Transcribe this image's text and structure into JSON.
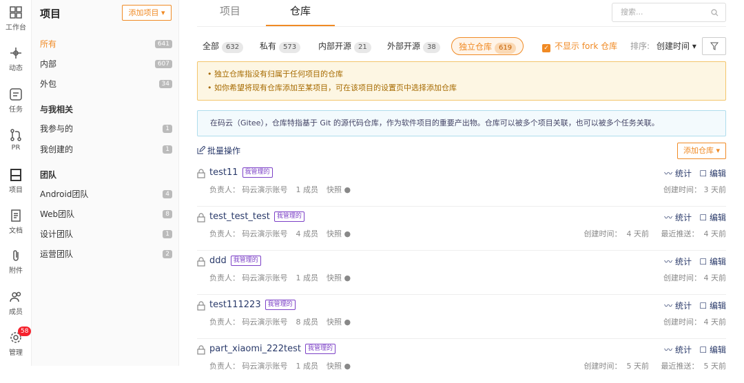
{
  "rail": [
    {
      "label": "工作台",
      "icon": "dashboard-icon"
    },
    {
      "label": "动态",
      "icon": "activity-icon"
    },
    {
      "label": "任务",
      "icon": "task-icon"
    },
    {
      "label": "PR",
      "icon": "pull-request-icon"
    },
    {
      "label": "项目",
      "icon": "project-icon"
    },
    {
      "label": "文档",
      "icon": "document-icon"
    },
    {
      "label": "附件",
      "icon": "attachment-icon"
    },
    {
      "label": "成员",
      "icon": "members-icon"
    },
    {
      "label": "管理",
      "icon": "settings-icon",
      "badge": "58"
    }
  ],
  "sidebar": {
    "title": "项目",
    "add_label": "添加项目 ▾",
    "items": [
      {
        "label": "所有",
        "count": "641"
      },
      {
        "label": "内部",
        "count": "607"
      },
      {
        "label": "外包",
        "count": "34"
      }
    ],
    "related_head": "与我相关",
    "related": [
      {
        "label": "我参与的",
        "count": "1"
      },
      {
        "label": "我创建的",
        "count": "1"
      }
    ],
    "team_head": "团队",
    "teams": [
      {
        "label": "Android团队",
        "count": "4"
      },
      {
        "label": "Web团队",
        "count": "8"
      },
      {
        "label": "设计团队",
        "count": "1"
      },
      {
        "label": "运营团队",
        "count": "2"
      }
    ]
  },
  "tabs": {
    "projects": "项目",
    "repos": "仓库"
  },
  "search": {
    "placeholder": "搜索..."
  },
  "filters": [
    {
      "label": "全部",
      "count": "632"
    },
    {
      "label": "私有",
      "count": "573"
    },
    {
      "label": "内部开源",
      "count": "21"
    },
    {
      "label": "外部开源",
      "count": "38"
    },
    {
      "label": "独立仓库",
      "count": "619"
    }
  ],
  "hide_fork": "不显示 fork 仓库",
  "sort": {
    "label": "排序:",
    "value": "创建时间 ▾"
  },
  "warn": {
    "line1": "独立仓库指没有归属于任何项目的仓库",
    "line2": "如你希望将现有仓库添加至某项目，可在该项目的设置页中选择添加仓库"
  },
  "info": "在码云（Gitee），仓库特指基于 Git 的源代码仓库，作为软件项目的重要产出物。仓库可以被多个项目关联，也可以被多个任务关联。",
  "batch": "批量操作",
  "add_repo": "添加仓库 ▾",
  "actions": {
    "stats": "统计",
    "edit": "编辑"
  },
  "repos": [
    {
      "name": "test11",
      "tag": "我管理的",
      "owner": "负责人：  码云演示账号",
      "members": "1 成员",
      "snapshot": "快照 ●",
      "right": "创建时间：  3 天前"
    },
    {
      "name": "test_test_test",
      "tag": "我管理的",
      "owner": "负责人：  码云演示账号",
      "members": "4 成员",
      "snapshot": "快照 ●",
      "right": "创建时间：  4 天前     最近推送：  4 天前"
    },
    {
      "name": "ddd",
      "tag": "我管理的",
      "owner": "负责人：  码云演示账号",
      "members": "1 成员",
      "snapshot": "快照 ●",
      "right": "创建时间：  4 天前"
    },
    {
      "name": "test111223",
      "tag": "我管理的",
      "owner": "负责人：  码云演示账号",
      "members": "8 成员",
      "snapshot": "快照 ●",
      "right": "创建时间：  4 天前"
    },
    {
      "name": "part_xiaomi_222test",
      "tag": "我管理的",
      "owner": "负责人：  码云演示账号",
      "members": "1 成员",
      "snapshot": "快照 ●",
      "right": "创建时间：  5 天前     最近推送：  5 天前"
    }
  ]
}
